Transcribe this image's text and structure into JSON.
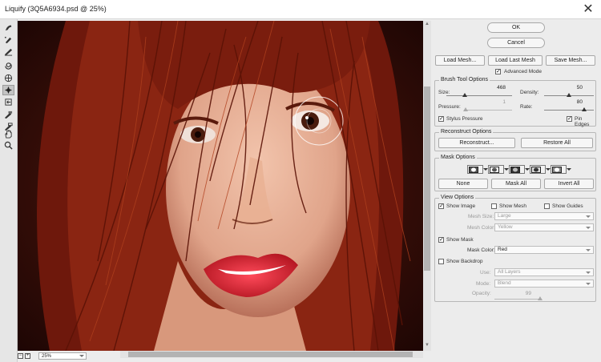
{
  "window": {
    "title": "Liquify (3Q5A6934.psd @ 25%)",
    "close_label": "✕"
  },
  "zoom": {
    "value": "25%"
  },
  "buttons": {
    "ok": "OK",
    "cancel": "Cancel",
    "load_mesh": "Load Mesh...",
    "load_last_mesh": "Load Last Mesh",
    "save_mesh": "Save Mesh..."
  },
  "advanced_mode": {
    "label": "Advanced Mode",
    "checked": true
  },
  "brush": {
    "title": "Brush Tool Options",
    "size_label": "Size:",
    "size_value": "468",
    "size_fraction": 0.28,
    "density_label": "Density:",
    "density_value": "50",
    "density_fraction": 0.5,
    "pressure_label": "Pressure:",
    "pressure_value": "1",
    "pressure_fraction": 0.0,
    "rate_label": "Rate:",
    "rate_value": "80",
    "rate_fraction": 0.8,
    "stylus_label": "Stylus Pressure",
    "pin_label": "Pin Edges"
  },
  "reconstruct": {
    "title": "Reconstruct Options",
    "reconstruct_button": "Reconstruct...",
    "restore_button": "Restore All"
  },
  "mask": {
    "title": "Mask Options",
    "none_button": "None",
    "mask_all_button": "Mask All",
    "invert_all_button": "Invert All"
  },
  "view": {
    "title": "View Options",
    "show_image": "Show Image",
    "show_mesh": "Show Mesh",
    "show_guides": "Show Guides",
    "mesh_size_label": "Mesh Size:",
    "mesh_size_value": "Large",
    "mesh_color_label": "Mesh Color:",
    "mesh_color_value": "Yellow",
    "show_mask": "Show Mask",
    "mask_color_label": "Mask Color:",
    "mask_color_value": "Red",
    "show_backdrop": "Show Backdrop",
    "use_label": "Use:",
    "use_value": "All Layers",
    "mode_label": "Mode:",
    "mode_value": "Blend",
    "opacity_label": "Opacity:",
    "opacity_value": "99",
    "opacity_fraction": 0.99
  },
  "tools": [
    "forward-warp-tool-icon",
    "reconstruct-tool-icon",
    "smooth-tool-icon",
    "twirl-tool-icon",
    "pucker-tool-icon",
    "bloat-tool-icon",
    "push-left-tool-icon",
    "freeze-mask-tool-icon",
    "thaw-mask-tool-icon",
    "hand-tool-icon",
    "zoom-tool-icon"
  ],
  "colors": {
    "accent": "#1a73e8",
    "lips": "#d8283a",
    "hair": "#7a1a0e"
  }
}
